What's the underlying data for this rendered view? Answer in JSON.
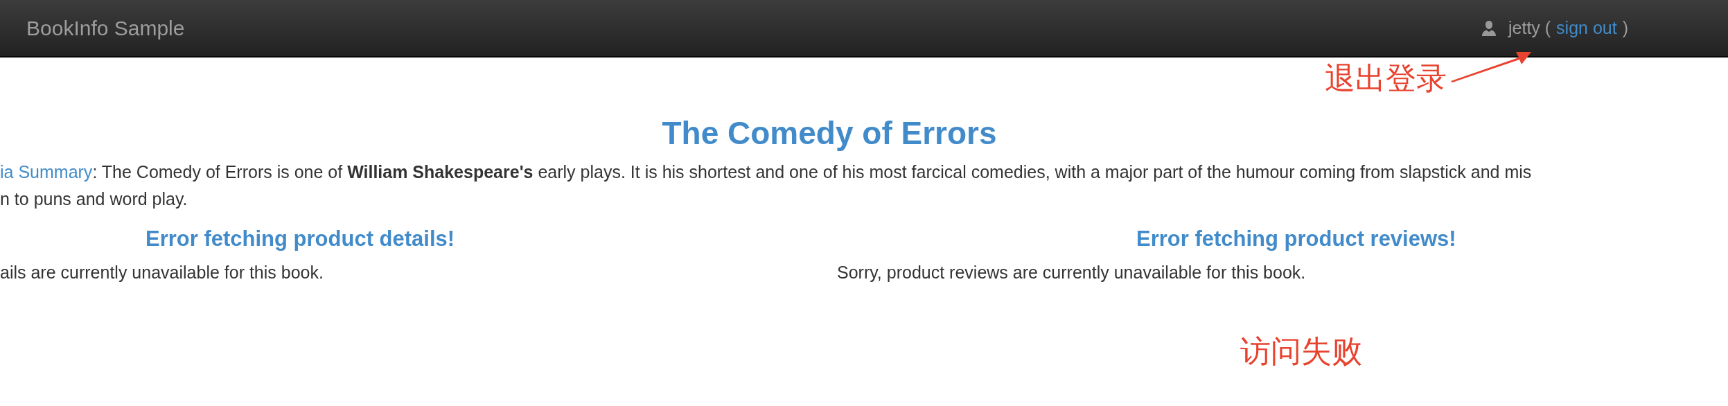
{
  "navbar": {
    "brand": "BookInfo Sample",
    "user": {
      "name": "jetty",
      "open_paren": "(",
      "link": "sign out",
      "close_paren": ")"
    }
  },
  "product": {
    "title": "The Comedy of Errors",
    "summary_link": "ia Summary",
    "summary_lines": [
      ": The Comedy of Errors is one of **William Shakespeare's** early plays. It is his shortest and one of his most farcical comedies, with a major part of the humour coming from slapstick and mis",
      "n to puns and word play."
    ]
  },
  "sections": [
    {
      "heading": "Error fetching product details!",
      "message": "ails are currently unavailable for this book."
    },
    {
      "heading": "Error fetching product reviews!",
      "message": "Sorry, product reviews are currently unavailable for this book."
    }
  ],
  "annotations": [
    {
      "kind": "arrow-label",
      "text": "退出登录",
      "color": "#e8432e"
    },
    {
      "kind": "label",
      "text": "访问失败",
      "color": "#e8432e"
    }
  ]
}
